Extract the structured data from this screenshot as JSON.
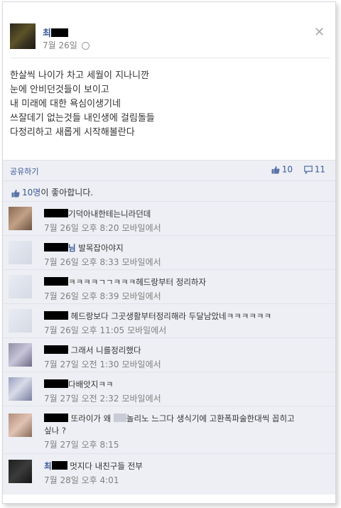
{
  "post": {
    "author_visible": "최",
    "date": "7월 26일",
    "body_lines": [
      "한살씩 나이가 차고 세월이 지나니깐",
      "눈에 안비던것들이 보이고",
      "내 미래에 대한 욕심이생기네",
      "쓰잘데기 없는것들 내인생에 걸림돌들",
      "다정리하고 새롭게 시작해볼란다"
    ]
  },
  "actions": {
    "share_label": "공유하기",
    "like_count": "10",
    "comment_count": "11"
  },
  "likes": {
    "count_text": "10명",
    "suffix": "이 좋아합니다."
  },
  "comments": [
    {
      "text": "기덕아내한테는니라던데",
      "time": "7월 26일 오후 8:20",
      "via": "모바일에서"
    },
    {
      "name_suffix": "님",
      "text": " 발목잡아야지",
      "time": "7월 26일 오후 8:33",
      "via": "모바일에서"
    },
    {
      "text": "ㅋㅋㅋㅋㄱㄱㅋㅋㅋ헤드랑부터 정리하자",
      "time": "7월 26일 오후 8:39",
      "via": "모바일에서"
    },
    {
      "text": " 헤드랑보다 그곳생활부터정리해라 두달남았네ㅋㅋㅋㅋㅋㅋ",
      "time": "7월 26일 오후 11:05",
      "via": "모바일에서"
    },
    {
      "text": " 그래서 니를정리했다",
      "time": "7월 27일 오전 1:30",
      "via": "모바일에서"
    },
    {
      "text": "다배앗지ㅋㅋ",
      "time": "7월 27일 오전 2:32",
      "via": "모바일에서"
    },
    {
      "text": " 또라이가 왜 ",
      "text2": "놀리노 느그다 생식기에 고환폭파술한대씩 꼽히고",
      "text3": "싶나 ?",
      "time": "7월 27일 오후 8:15",
      "via": ""
    },
    {
      "name_visible": "최",
      "text": " 멋지다 내친구들 전부",
      "time": "7월 28일 오후 4:01",
      "via": ""
    }
  ],
  "colors": {
    "link": "#3b5998",
    "meta": "#808080",
    "panel": "#edeff4"
  }
}
